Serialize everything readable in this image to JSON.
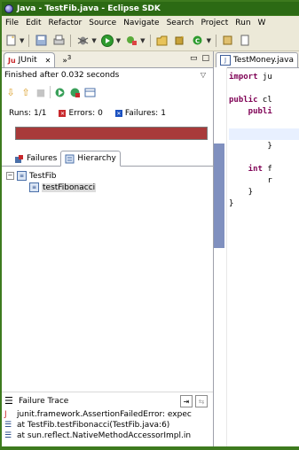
{
  "window": {
    "title": "Java - TestFib.java - Eclipse SDK"
  },
  "menu": [
    "File",
    "Edit",
    "Refactor",
    "Source",
    "Navigate",
    "Search",
    "Project",
    "Run",
    "W"
  ],
  "junit_view": {
    "tab_label": "JUnit",
    "more_views": "»",
    "more_views_count": "3",
    "status": "Finished after 0.032 seconds",
    "runs_label": "Runs:",
    "runs_value": "1/1",
    "errors_label": "Errors:",
    "errors_value": "0",
    "failures_label": "Failures:",
    "failures_value": "1",
    "progress_fraction": 1.0,
    "progress_color": "#a83a3a",
    "tabs": {
      "failures": "Failures",
      "hierarchy": "Hierarchy"
    },
    "tree": {
      "root": "TestFib",
      "child": "testFibonacci"
    },
    "failure_trace_label": "Failure Trace",
    "trace": [
      "junit.framework.AssertionFailedError: expec",
      "at TestFib.testFibonacci(TestFib.java:6)",
      "at sun.reflect.NativeMethodAccessorImpl.in"
    ]
  },
  "editor": {
    "tab_label": "TestMoney.java",
    "lines": [
      {
        "kw": "import",
        "rest": " ju"
      },
      {
        "kw": "",
        "rest": ""
      },
      {
        "kw": "public",
        "rest": " cl"
      },
      {
        "kw": "    publi",
        "rest": ""
      },
      {
        "kw": "",
        "rest": ""
      },
      {
        "kw": "",
        "rest": ""
      },
      {
        "kw": "",
        "rest": "        }"
      },
      {
        "kw": "",
        "rest": ""
      },
      {
        "kw": "    int",
        "rest": " f"
      },
      {
        "kw": "",
        "rest": "        r"
      },
      {
        "kw": "",
        "rest": "    }"
      },
      {
        "kw": "",
        "rest": "}"
      }
    ]
  },
  "colors": {
    "title_bar": "#2c6a14",
    "error": "#c8282c",
    "failure": "#1a50c0"
  }
}
